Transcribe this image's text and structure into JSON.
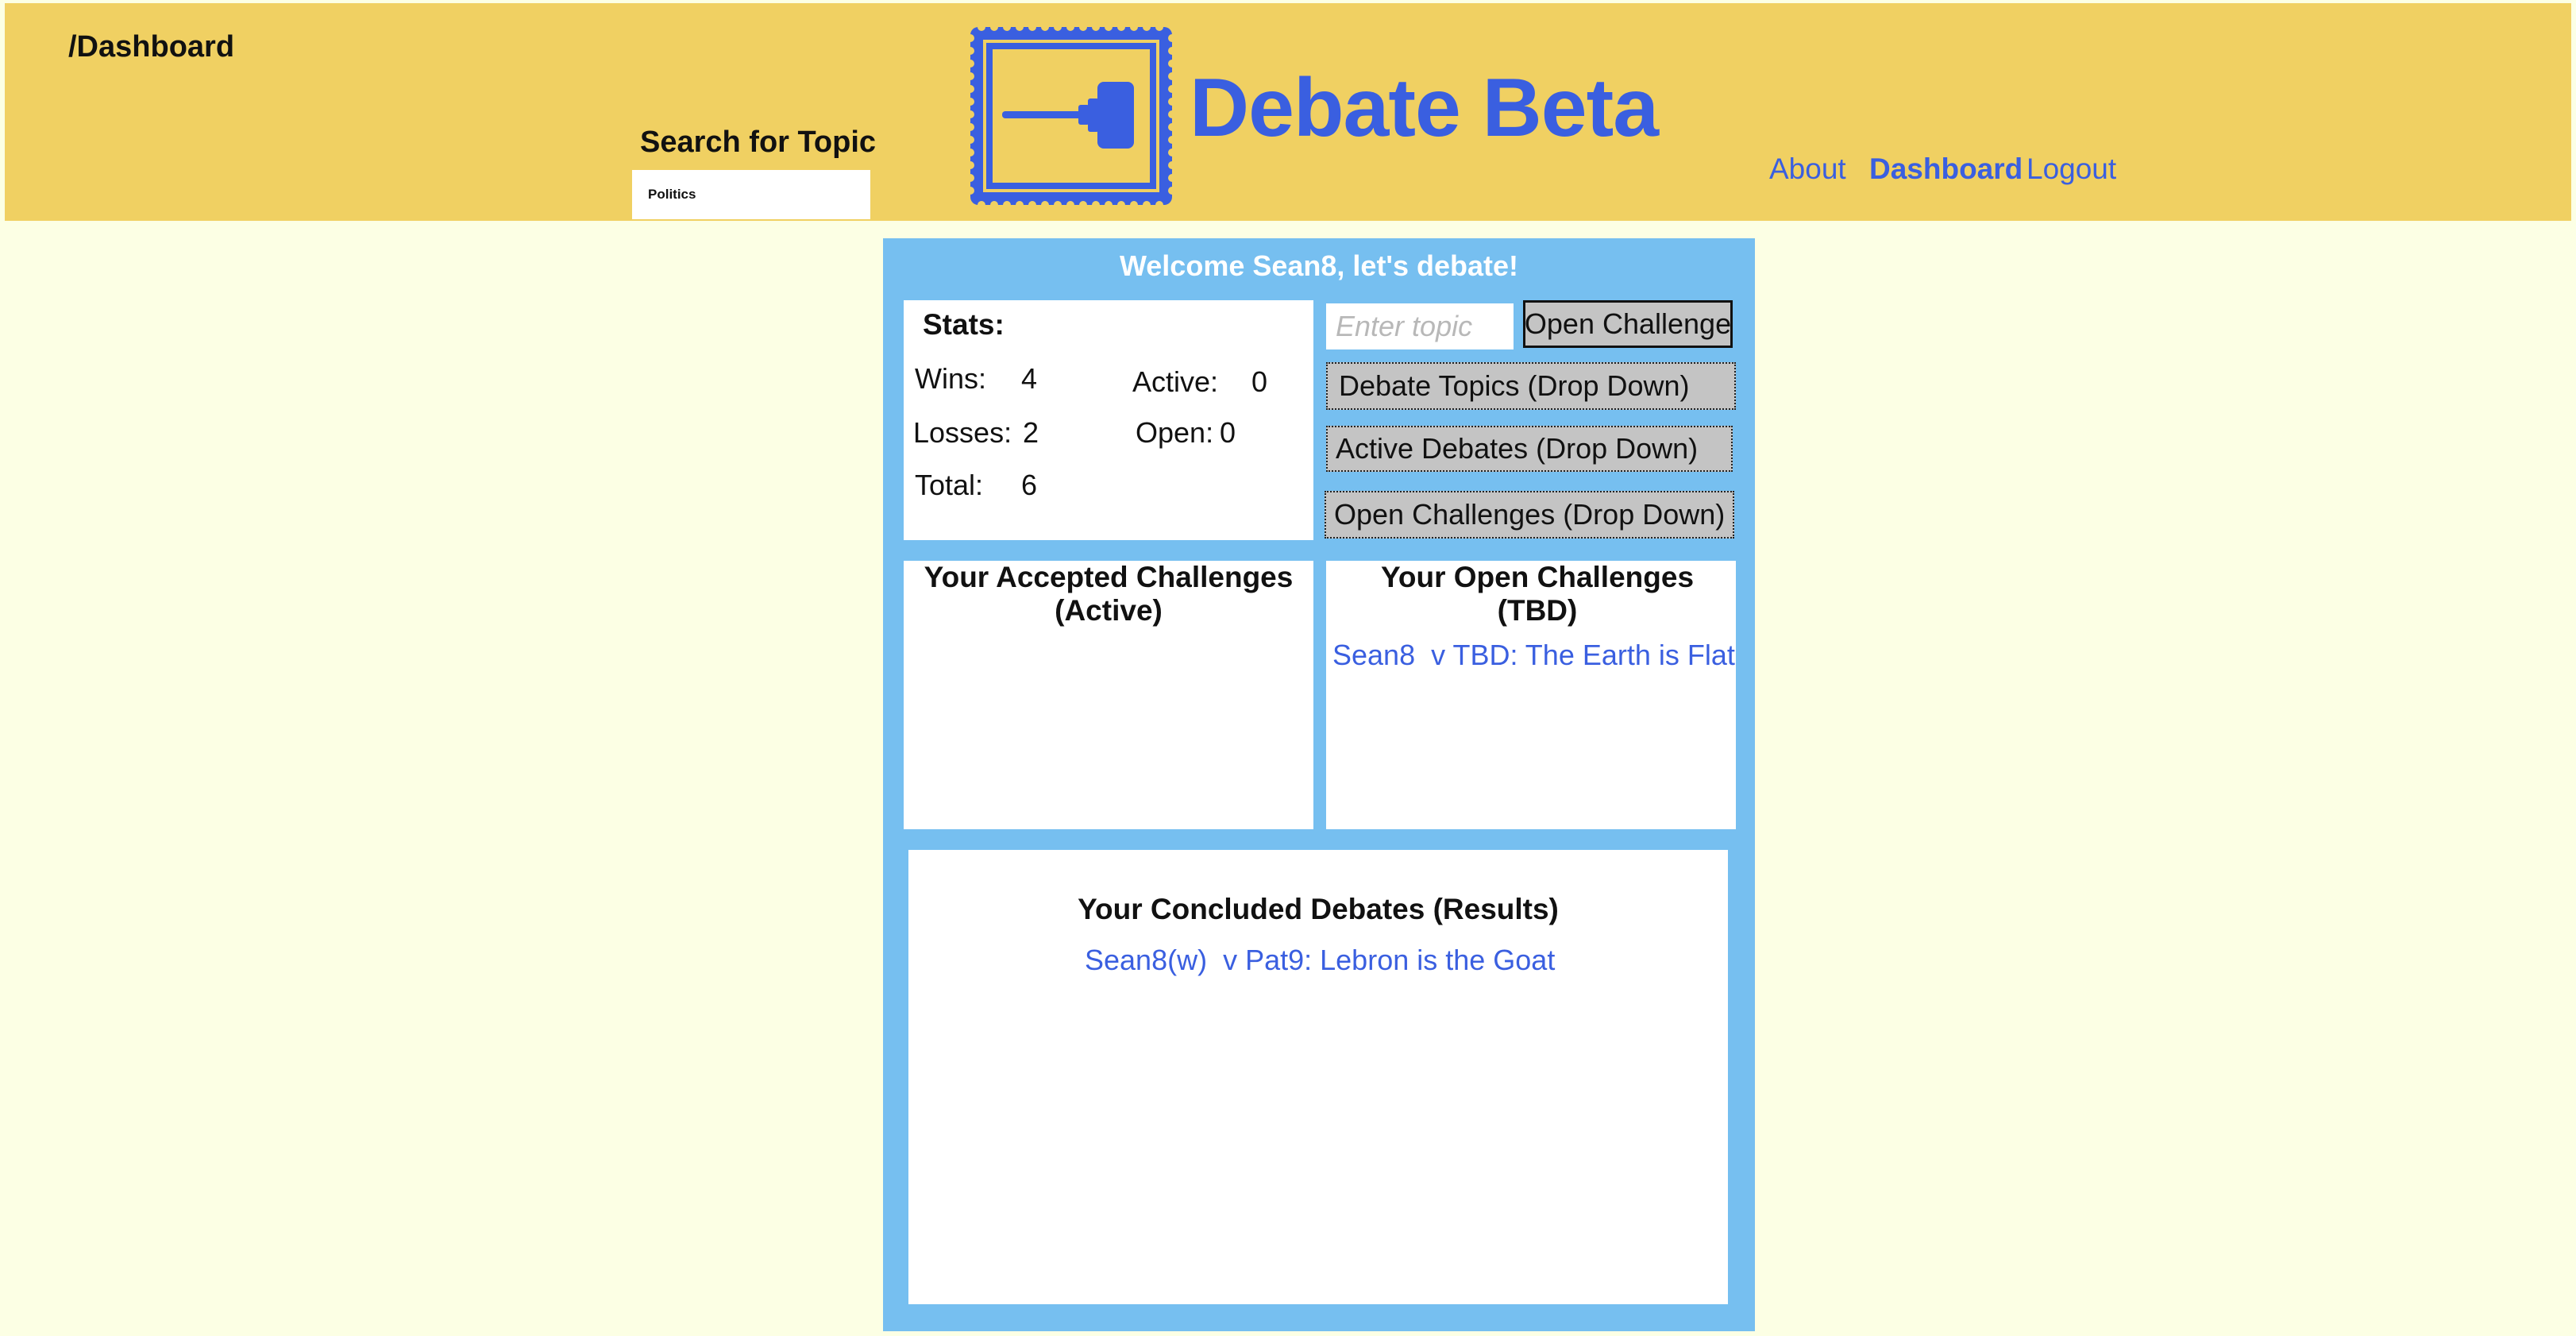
{
  "header": {
    "breadcrumb": "/Dashboard",
    "search": {
      "label": "Search for Topic",
      "value": "Politics"
    },
    "app_title": "Debate Beta",
    "nav": {
      "about": "About",
      "dashboard": "Dashboard",
      "logout": "Logout"
    }
  },
  "dashboard": {
    "welcome": "Welcome Sean8, let's debate!",
    "stats": {
      "title": "Stats:",
      "wins_label": "Wins:",
      "wins": "4",
      "losses_label": "Losses:",
      "losses": "2",
      "total_label": "Total:",
      "total": "6",
      "active_label": "Active:",
      "active": "0",
      "open_label": "Open:",
      "open": "0"
    },
    "challenge": {
      "topic_placeholder": "Enter topic",
      "open_challenge_label": "Open Challenge"
    },
    "dropdowns": {
      "debate_topics": "Debate Topics (Drop Down)",
      "active_debates": "Active Debates (Drop Down)",
      "open_challenges": "Open Challenges (Drop Down)"
    },
    "accepted": {
      "title_line1": "Your Accepted Challenges",
      "title_line2": "(Active)"
    },
    "open_challenges": {
      "title_line1": "Your Open Challenges",
      "title_line2": "(TBD)",
      "items": [
        "Sean8  v TBD: The Earth is Flat"
      ]
    },
    "concluded": {
      "title": "Your Concluded Debates (Results)",
      "items": [
        "Sean8(w)  v Pat9: Lebron is the Goat"
      ]
    }
  },
  "colors": {
    "page_background": "#fcffe4",
    "header_background": "#f0d062",
    "accent_blue": "#3a5fe0",
    "panel_background": "#76bff0",
    "button_gray": "#c4c4c4"
  },
  "icons": {
    "logo": "gavel-stamp-icon"
  }
}
